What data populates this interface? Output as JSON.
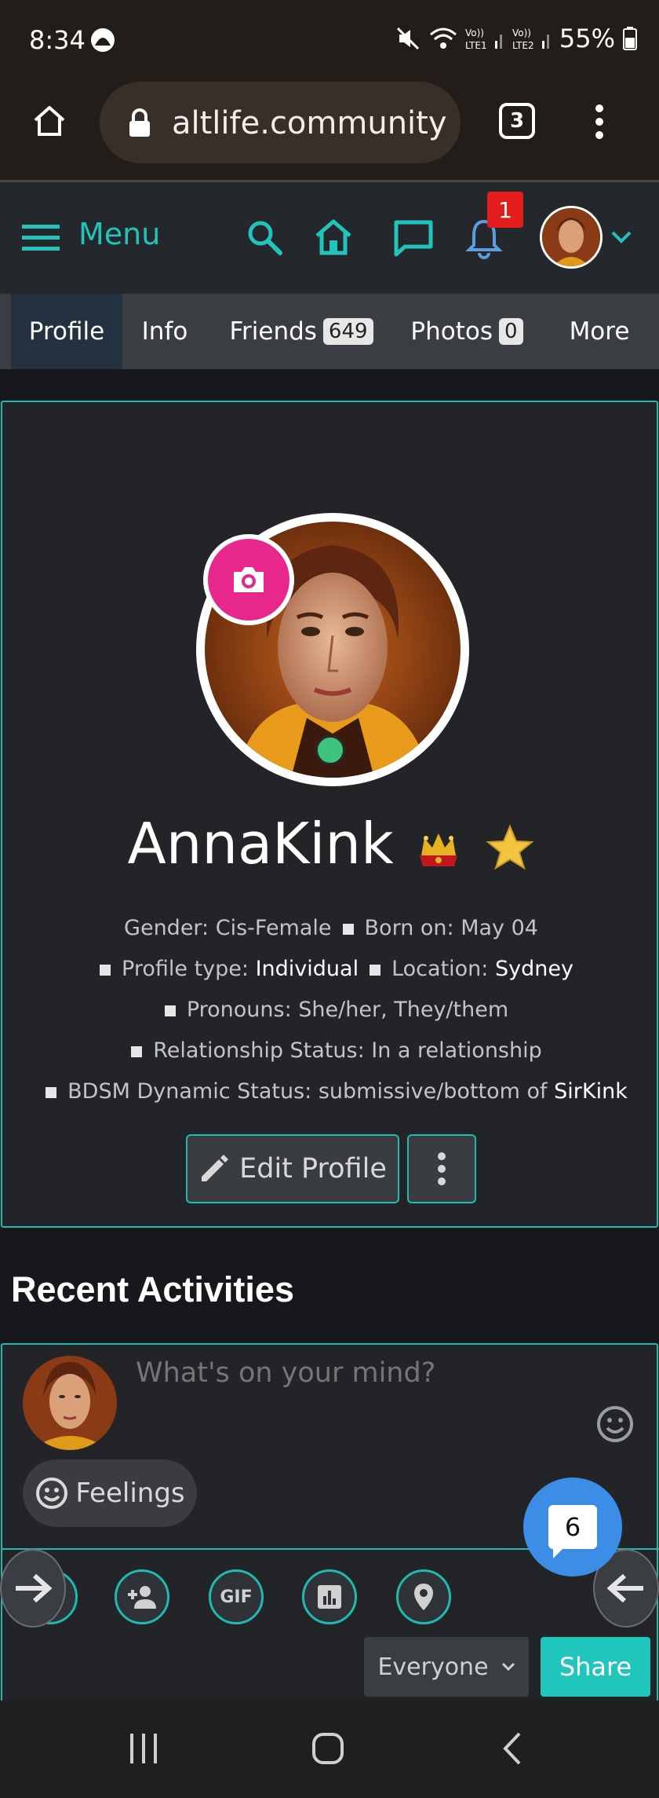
{
  "status_bar": {
    "time": "8:34",
    "battery": "55%",
    "tab_count": "3"
  },
  "browser": {
    "url": "altlife.community"
  },
  "header": {
    "menu_label": "Menu",
    "notification_count": "1"
  },
  "tabs": [
    {
      "label": "Profile",
      "count": null
    },
    {
      "label": "Info",
      "count": null
    },
    {
      "label": "Friends",
      "count": "649"
    },
    {
      "label": "Photos",
      "count": "0"
    },
    {
      "label": "More",
      "count": null
    }
  ],
  "profile": {
    "name": "AnnaKink",
    "gender": "Gender: Cis-Female",
    "born": "Born on: May 04",
    "profile_type_label": "Profile type:",
    "profile_type_value": "Individual",
    "location_label": "Location:",
    "location_value": "Sydney",
    "pronouns": "Pronouns: She/her, They/them",
    "relationship": "Relationship Status: In a relationship",
    "bdsm_label": "BDSM Dynamic Status: submissive/bottom of",
    "bdsm_partner": "SirKink",
    "edit_label": "Edit Profile"
  },
  "activities": {
    "title": "Recent Activities",
    "composer_placeholder": "What's on your mind?",
    "feelings_label": "Feelings",
    "gif_label": "GIF",
    "audience": "Everyone",
    "share_label": "Share",
    "chat_count": "6"
  },
  "colors": {
    "accent": "#1fbab1",
    "camera": "#e8278c",
    "online": "#3ec47c",
    "chat": "#3b8de5",
    "badge": "#e41c1c"
  }
}
